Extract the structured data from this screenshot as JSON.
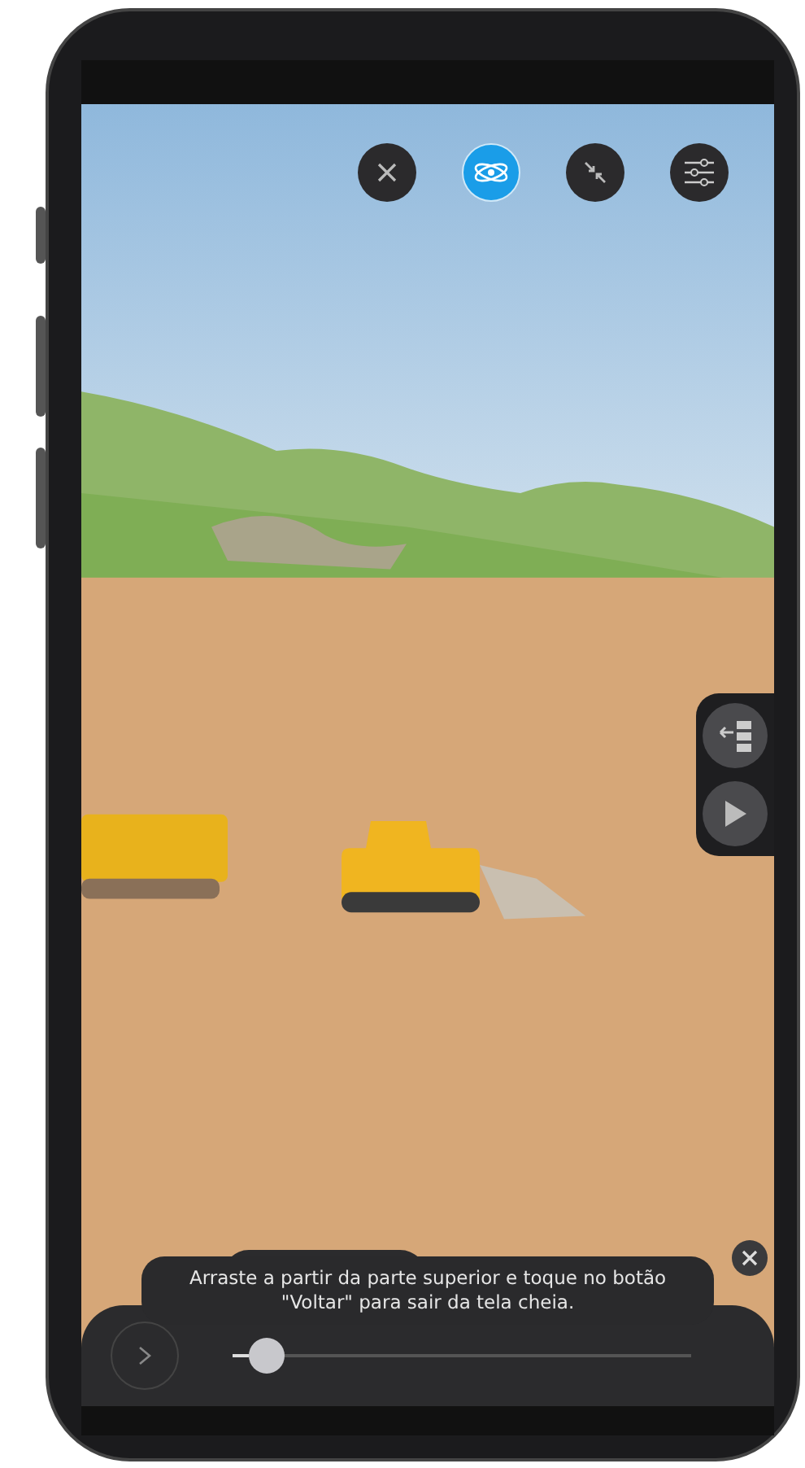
{
  "toolbar": [
    {
      "kind": "close",
      "selected": false
    },
    {
      "kind": "orbit",
      "selected": true
    },
    {
      "kind": "collapse",
      "selected": false
    },
    {
      "kind": "settings",
      "selected": false
    }
  ],
  "side_panel": [
    {
      "kind": "exit"
    },
    {
      "kind": "play"
    }
  ],
  "bottom_panel": {
    "slider": {
      "level": 0.07
    }
  },
  "toast": {
    "message": "Arraste a partir da parte superior e toque no botão \"Voltar\" para sair da tela cheia."
  }
}
